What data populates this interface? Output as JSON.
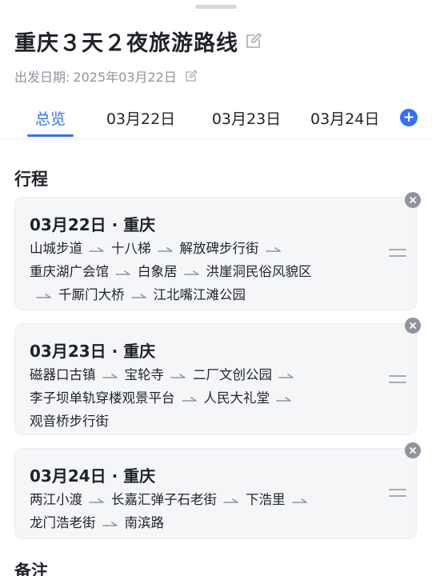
{
  "header": {
    "title": "重庆３天２夜旅游路线",
    "date_label": "出发日期:",
    "date_value": "2025年03月22日"
  },
  "tabs": [
    {
      "label": "总览",
      "active": true
    },
    {
      "label": "03月22日",
      "active": false
    },
    {
      "label": "03月23日",
      "active": false
    },
    {
      "label": "03月24日",
      "active": false
    }
  ],
  "sections": {
    "itinerary_title": "行程",
    "notes_title": "备注"
  },
  "days": [
    {
      "header": "03月22日 · 重庆",
      "stops": [
        "山城步道",
        "十八梯",
        "解放碑步行街",
        "重庆湖广会馆",
        "白象居",
        "洪崖洞民俗风貌区",
        "千厮门大桥",
        "江北嘴江滩公园"
      ]
    },
    {
      "header": "03月23日 · 重庆",
      "stops": [
        "磁器口古镇",
        "宝轮寺",
        "二厂文创公园",
        "李子坝单轨穿楼观景平台",
        "人民大礼堂",
        "观音桥步行街"
      ]
    },
    {
      "header": "03月24日 · 重庆",
      "stops": [
        "两江小渡",
        "长嘉汇弹子石老街",
        "下浩里",
        "龙门浩老街",
        "南滨路"
      ]
    }
  ],
  "colors": {
    "accent": "#3370ff",
    "card_bg": "#f5f6f7",
    "muted_text": "#8f959e"
  },
  "icons": {
    "edit": "edit-icon",
    "add": "plus-circle-icon",
    "close": "close-circle-icon",
    "drag": "drag-handle-icon",
    "arrow": "arrow-right-icon"
  }
}
